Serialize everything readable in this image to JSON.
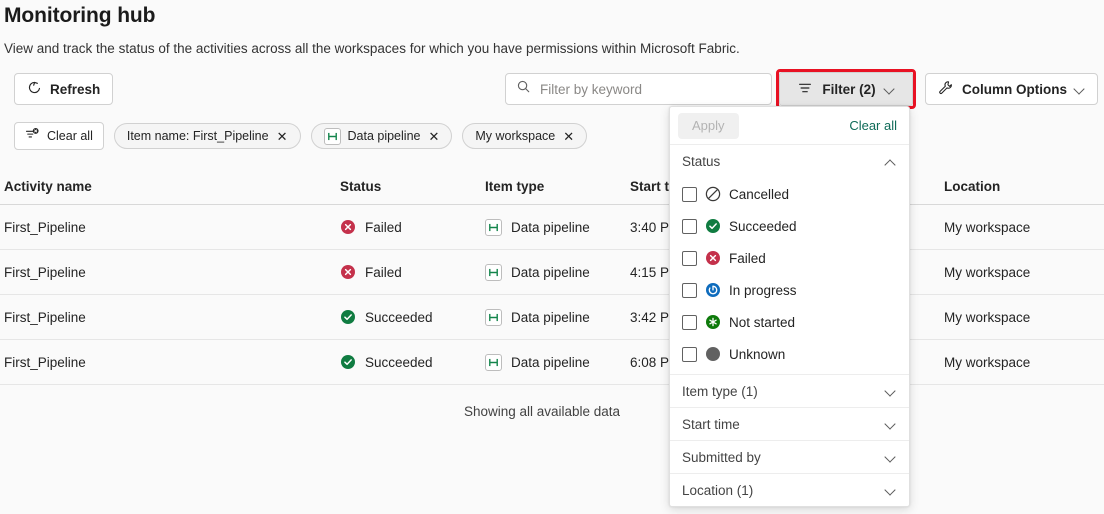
{
  "header": {
    "title": "Monitoring hub",
    "subtitle": "View and track the status of the activities across all the workspaces for which you have permissions within Microsoft Fabric."
  },
  "commandbar": {
    "refresh_label": "Refresh",
    "search_placeholder": "Filter by keyword",
    "search_value": "",
    "filter_label": "Filter (2)",
    "column_options_label": "Column Options"
  },
  "chips": {
    "clear_all_label": "Clear all",
    "items": [
      {
        "label": "Item name: First_Pipeline",
        "icon": "",
        "close": "✕"
      },
      {
        "label": "Data pipeline",
        "icon": "data-pipeline-icon",
        "close": "✕"
      },
      {
        "label": "My workspace",
        "icon": "",
        "close": "✕"
      }
    ]
  },
  "table": {
    "columns": [
      "Activity name",
      "Status",
      "Item type",
      "Start time",
      "Location"
    ],
    "rows": [
      {
        "activity": "First_Pipeline",
        "status": "Failed",
        "status_icon": "failed-icon",
        "item_type": "Data pipeline",
        "start": "3:40 P",
        "location": "My workspace"
      },
      {
        "activity": "First_Pipeline",
        "status": "Failed",
        "status_icon": "failed-icon",
        "item_type": "Data pipeline",
        "start": "4:15 P",
        "location": "My workspace"
      },
      {
        "activity": "First_Pipeline",
        "status": "Succeeded",
        "status_icon": "succeeded-icon",
        "item_type": "Data pipeline",
        "start": "3:42 P",
        "location": "My workspace"
      },
      {
        "activity": "First_Pipeline",
        "status": "Succeeded",
        "status_icon": "succeeded-icon",
        "item_type": "Data pipeline",
        "start": "6:08 P",
        "location": "My workspace"
      }
    ],
    "footnote": "Showing all available data"
  },
  "filter_panel": {
    "apply_label": "Apply",
    "clear_all_label": "Clear all",
    "status_section": {
      "label": "Status",
      "expanded": true,
      "options": [
        {
          "label": "Cancelled",
          "icon": "cancelled-icon",
          "checked": false
        },
        {
          "label": "Succeeded",
          "icon": "succeeded-icon",
          "checked": false
        },
        {
          "label": "Failed",
          "icon": "failed-icon",
          "checked": false
        },
        {
          "label": "In progress",
          "icon": "in-progress-icon",
          "checked": false
        },
        {
          "label": "Not started",
          "icon": "not-started-icon",
          "checked": false
        },
        {
          "label": "Unknown",
          "icon": "unknown-icon",
          "checked": false
        }
      ]
    },
    "sections": [
      {
        "label": "Item type (1)",
        "expanded": false
      },
      {
        "label": "Start time",
        "expanded": false
      },
      {
        "label": "Submitted by",
        "expanded": false
      },
      {
        "label": "Location (1)",
        "expanded": false
      }
    ]
  },
  "colors": {
    "highlight": "#e81123",
    "failed": "#c4314b",
    "succeeded": "#107c41",
    "in_progress": "#0f6cbd",
    "not_started": "#0e7a0b",
    "unknown": "#616161",
    "link": "#0f6b58",
    "pipeline_green": "#11844a"
  }
}
